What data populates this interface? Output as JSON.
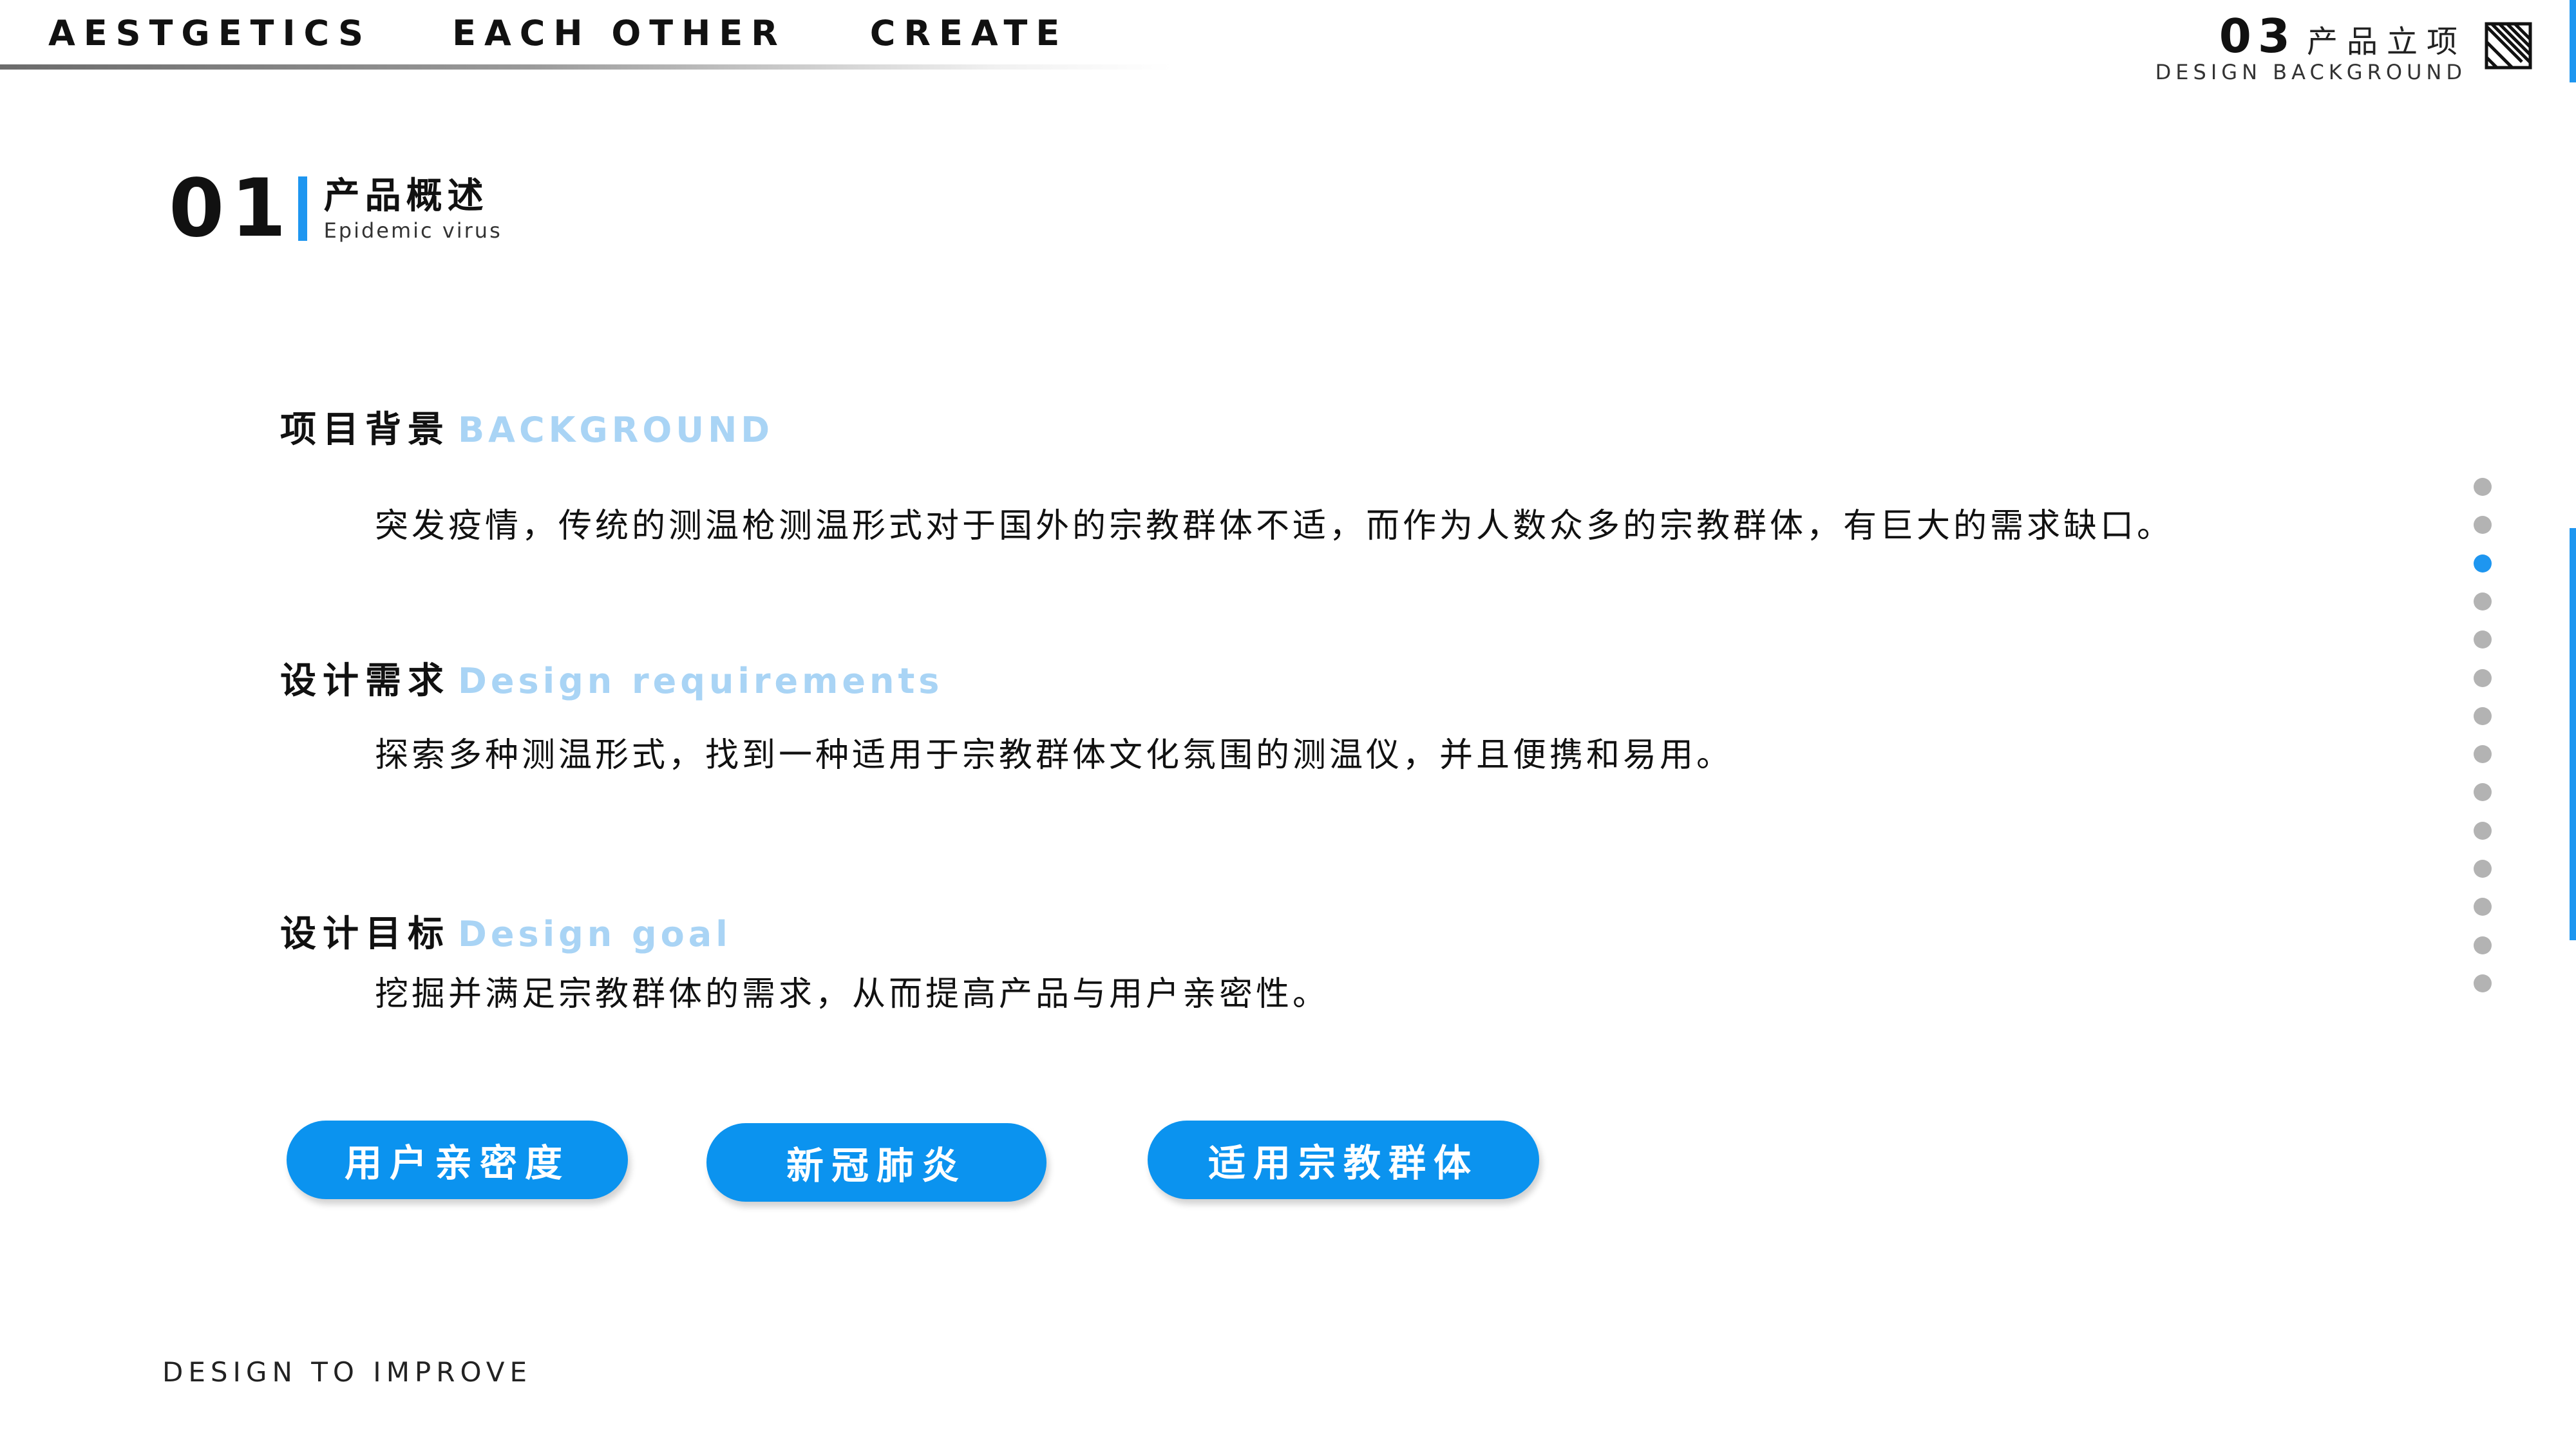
{
  "header": {
    "nav": [
      "AESTGETICS",
      "EACH OTHER",
      "CREATE"
    ],
    "chapter_number": "03",
    "chapter_title": "产品立项",
    "chapter_subtitle": "DESIGN BACKGROUND",
    "icon": "hatch-square-icon"
  },
  "section": {
    "number": "01",
    "title": "产品概述",
    "subtitle": "Epidemic virus"
  },
  "blocks": {
    "background": {
      "title": "项目背景",
      "en": "BACKGROUND",
      "text": "突发疫情，传统的测温枪测温形式对于国外的宗教群体不适，而作为人数众多的宗教群体，有巨大的需求缺口。"
    },
    "requirements": {
      "title": "设计需求",
      "en": "Design requirements",
      "text": "探索多种测温形式，找到一种适用于宗教群体文化氛围的测温仪，并且便携和易用。"
    },
    "goal": {
      "title": "设计目标",
      "en": "Design goal",
      "text": "挖掘并满足宗教群体的需求，从而提高产品与用户亲密性。"
    }
  },
  "tags": [
    "用户亲密度",
    "新冠肺炎",
    "适用宗教群体"
  ],
  "footer": {
    "text": "DESIGN TO IMPROVE"
  },
  "pagination": {
    "total": 14,
    "active_index": 2
  },
  "colors": {
    "accent": "#1e96f0",
    "tag_fill": "#0b93ef",
    "english_label": "#a9d4f5",
    "dot_inactive": "#b3b3b3",
    "text": "#111111"
  }
}
